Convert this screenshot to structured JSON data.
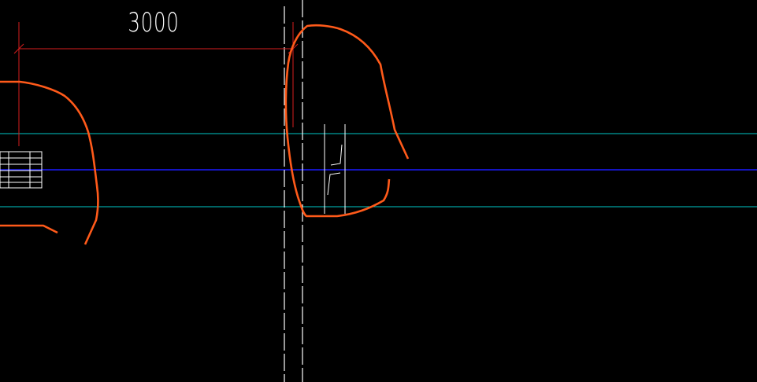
{
  "drawing": {
    "dimension": {
      "label": "3000"
    },
    "colors": {
      "background": "#000000",
      "dimension_line": "#d81e1e",
      "dimension_text": "#ffffff",
      "markup_cloud": "#ff5a1a",
      "cyan_line": "#00c8c8",
      "blue_line": "#1a1aff",
      "dashed_line": "#ffffff",
      "hatch": "#ffffff"
    }
  }
}
